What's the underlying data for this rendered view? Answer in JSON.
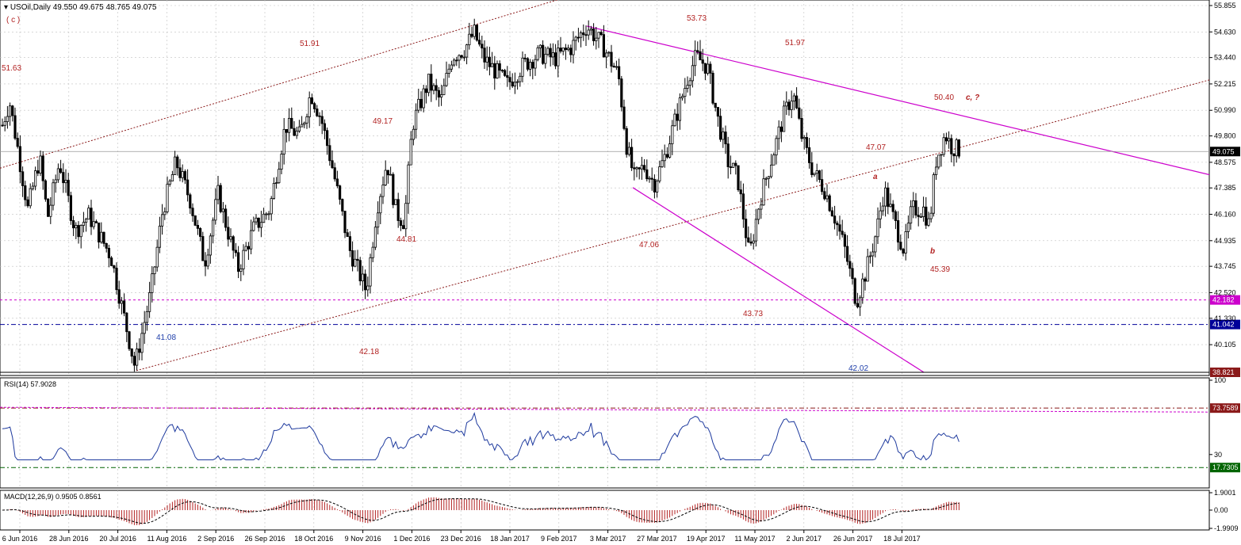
{
  "symbol_header": {
    "title": "USOil,Daily",
    "ohlc": "49.550 49.675 48.765 49.075",
    "wave_label": "( c )"
  },
  "price_panel": {
    "y_ticks": [
      "55.855",
      "54.630",
      "53.440",
      "52.215",
      "50.990",
      "49.800",
      "48.575",
      "47.385",
      "46.160",
      "44.935",
      "43.745",
      "42.520",
      "41.330",
      "40.105"
    ],
    "current_price_tag": "49.075",
    "bottom_price_tag": "38.821",
    "h_lines": [
      {
        "name": "magenta-level",
        "value": 42.182,
        "label": "42.182",
        "color": "#cc00cc"
      },
      {
        "name": "blue-level",
        "value": 41.042,
        "label": "41.042",
        "color": "#000099"
      }
    ],
    "annotations": [
      {
        "text": "51.63",
        "x": 0,
        "y": 51.63,
        "color": "#b22222"
      },
      {
        "text": "51.91",
        "x": 120,
        "y": 53.8,
        "color": "#b22222"
      },
      {
        "text": "53.73",
        "x": 257,
        "y": 55.5,
        "color": "#b22222"
      },
      {
        "text": "51.97",
        "x": 300,
        "y": 53.8,
        "color": "#b22222"
      },
      {
        "text": "49.17",
        "x": 150,
        "y": 50.4,
        "color": "#b22222"
      },
      {
        "text": "50.40",
        "x": 370,
        "y": 51.5,
        "color": "#b22222"
      },
      {
        "text": "c, ?",
        "x": 380,
        "y": 51.5,
        "color": "#b22222",
        "italic": true
      },
      {
        "text": "47.07",
        "x": 340,
        "y": 49.3,
        "color": "#b22222"
      },
      {
        "text": "a",
        "x": 344,
        "y": 48.1,
        "color": "#b22222",
        "italic": true
      },
      {
        "text": "47.06",
        "x": 245,
        "y": 45.2,
        "color": "#b22222"
      },
      {
        "text": "44.81",
        "x": 158,
        "y": 44.5,
        "color": "#b22222"
      },
      {
        "text": "b",
        "x": 366,
        "y": 45.0,
        "color": "#b22222",
        "italic": true
      },
      {
        "text": "45.39",
        "x": 366,
        "y": 43.9,
        "color": "#b22222"
      },
      {
        "text": "43.73",
        "x": 285,
        "y": 41.6,
        "color": "#b22222"
      },
      {
        "text": "41.08",
        "x": 58,
        "y": 40.6,
        "color": "#1f3faa"
      },
      {
        "text": "42.02",
        "x": 334,
        "y": 39.9,
        "color": "#1f3faa"
      },
      {
        "text": "42.18",
        "x": 138,
        "y": 39.6,
        "color": "#b22222"
      }
    ]
  },
  "rsi_panel": {
    "label": "RSI(14) 57.9028",
    "y_ticks": [
      "100",
      "30"
    ],
    "level_tags": [
      "73.7589",
      "17.7305"
    ]
  },
  "macd_panel": {
    "label": "MACD(12,26,9) 0.9505 0.8561",
    "y_ticks": [
      "1.9001",
      "0.00",
      "-1.9909"
    ]
  },
  "x_axis": {
    "labels": [
      "6 Jun 2016",
      "28 Jun 2016",
      "20 Jul 2016",
      "11 Aug 2016",
      "2 Sep 2016",
      "26 Sep 2016",
      "18 Oct 2016",
      "9 Nov 2016",
      "1 Dec 2016",
      "23 Dec 2016",
      "18 Jan 2017",
      "9 Feb 2017",
      "3 Mar 2017",
      "27 Mar 2017",
      "19 Apr 2017",
      "11 May 2017",
      "2 Jun 2017",
      "26 Jun 2017",
      "18 Jul 2017"
    ]
  },
  "colors": {
    "grid": "#c0c0c0",
    "text": "#000000",
    "annotation": "#b22222",
    "trendline_magenta": "#cc00cc",
    "channel_dashed": "#8b1a1a",
    "rsi_line": "#1e3a9e",
    "macd_hist": "#b22222",
    "tag_bg": "#000000",
    "tag_red_bg": "#8b1a1a"
  },
  "chart_data": {
    "type": "candlestick",
    "symbol": "USOil",
    "timeframe": "Daily",
    "last_bar": {
      "open": 49.55,
      "high": 49.675,
      "low": 48.765,
      "close": 49.075
    },
    "pivots": [
      {
        "label": "51.63",
        "date": "6 Jun 2016",
        "price": 51.63,
        "type": "high"
      },
      {
        "label": "41.08",
        "date": "1 Aug 2016",
        "price": 39.1,
        "type": "low"
      },
      {
        "label": "51.91",
        "date": "19 Oct 2016",
        "price": 51.91,
        "type": "high"
      },
      {
        "label": "42.18",
        "date": "14 Nov 2016",
        "price": 42.2,
        "type": "low"
      },
      {
        "label": "54.6",
        "date": "3 Jan 2017",
        "price": 55.2,
        "type": "high"
      },
      {
        "label": "54.9",
        "date": "22 Feb 2017",
        "price": 54.9,
        "type": "high"
      },
      {
        "label": "47.06",
        "date": "14 Mar 2017",
        "price": 47.1,
        "type": "low"
      },
      {
        "label": "53.73",
        "date": "12 Apr 2017",
        "price": 53.6,
        "type": "high"
      },
      {
        "label": "43.73",
        "date": "5 May 2017",
        "price": 43.8,
        "type": "low"
      },
      {
        "label": "51.97",
        "date": "25 May 2017",
        "price": 51.9,
        "type": "high"
      },
      {
        "label": "42.02",
        "date": "21 Jun 2017",
        "price": 42.1,
        "type": "low"
      },
      {
        "label": "47.07",
        "date": "4 Jul 2017",
        "price": 47.3,
        "type": "high"
      },
      {
        "label": "45.39",
        "date": "11 Jul 2017",
        "price": 45.4,
        "type": "low"
      },
      {
        "label": "50.40",
        "date": "31 Jul 2017",
        "price": 50.2,
        "type": "high"
      }
    ],
    "horizontal_levels": [
      42.182,
      41.042
    ],
    "y_range": [
      38.821,
      56.0
    ],
    "rsi": {
      "period": 14,
      "last": 57.9028,
      "levels": [
        73.7589,
        17.7305
      ],
      "range": [
        0,
        100
      ]
    },
    "macd": {
      "params": [
        12,
        26,
        9
      ],
      "main": 0.9505,
      "signal": 0.8561,
      "range": [
        -1.9909,
        1.9001
      ]
    }
  }
}
